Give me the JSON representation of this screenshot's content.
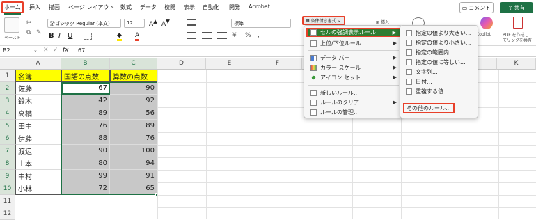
{
  "tabs": [
    "ホーム",
    "挿入",
    "描画",
    "ページ レイアウト",
    "数式",
    "データ",
    "校閲",
    "表示",
    "自動化",
    "開発",
    "Acrobat"
  ],
  "comment_label": "コメント",
  "share_label": "共有",
  "ribbon": {
    "paste": "ペースト",
    "font_name": "游ゴシック Regular (本文)",
    "font_size": "12",
    "number_format": "標準",
    "conditional_format": "条件付き書式",
    "insert": "挿入",
    "copilot": "Copilot",
    "pdf_line1": "PDF を作成し",
    "pdf_line2": "てリンクを共有"
  },
  "formula_bar": {
    "cell_ref": "B2",
    "fx": "fx",
    "value": "67"
  },
  "columns": [
    "A",
    "B",
    "C",
    "D",
    "E",
    "F",
    "G",
    "H",
    "I",
    "J",
    "K"
  ],
  "rows": [
    "1",
    "2",
    "3",
    "4",
    "5",
    "6",
    "7",
    "8",
    "9",
    "10",
    "11",
    "12"
  ],
  "table": {
    "headers": [
      "名簿",
      "国語の点数",
      "算数の点数"
    ],
    "records": [
      {
        "name": "佐藤",
        "kokugo": "67",
        "sansu": "90"
      },
      {
        "name": "鈴木",
        "kokugo": "42",
        "sansu": "92"
      },
      {
        "name": "高橋",
        "kokugo": "89",
        "sansu": "56"
      },
      {
        "name": "田中",
        "kokugo": "76",
        "sansu": "89"
      },
      {
        "name": "伊藤",
        "kokugo": "88",
        "sansu": "76"
      },
      {
        "name": "渡辺",
        "kokugo": "90",
        "sansu": "100"
      },
      {
        "name": "山本",
        "kokugo": "80",
        "sansu": "94"
      },
      {
        "name": "中村",
        "kokugo": "99",
        "sansu": "91"
      },
      {
        "name": "小林",
        "kokugo": "72",
        "sansu": "65"
      }
    ]
  },
  "menu_main": [
    "セルの強調表示ルール",
    "上位/下位ルール",
    "データ バー",
    "カラー スケール",
    "アイコン セット",
    "新しいルール...",
    "ルールのクリア",
    "ルールの管理..."
  ],
  "menu_sub": [
    "指定の値より大きい...",
    "指定の値より小さい...",
    "指定の範囲内...",
    "指定の値に等しい...",
    "文字列...",
    "日付...",
    "重複する値...",
    "その他のルール..."
  ],
  "colors": {
    "accent": "#1e7145",
    "highlight": "#e8402a",
    "yellow": "#ffff00",
    "selected_fill": "#c8c8c8"
  }
}
